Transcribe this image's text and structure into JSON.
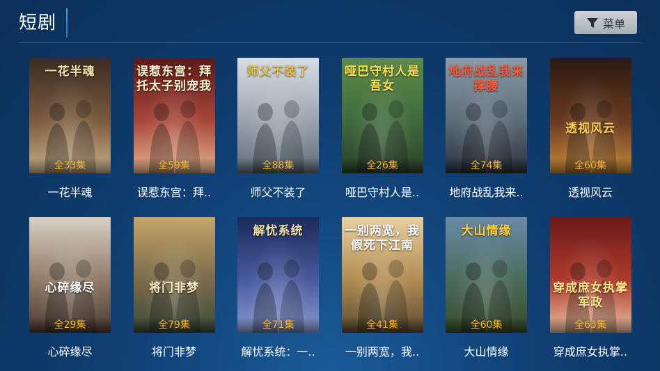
{
  "header": {
    "title": "短剧",
    "menu_label": "菜单",
    "menu_icon": "filter-icon"
  },
  "items": [
    {
      "title": "一花半魂",
      "episodes": "全33集",
      "poster_text": "一花半魂",
      "theme": [
        "#3b2b22",
        "#7a5b3e",
        "#c8b08a"
      ],
      "text_color": "#f2e2b0"
    },
    {
      "title": "误惹东宫：拜..",
      "episodes": "全59集",
      "poster_text": "误惹东宫：拜托太子别宠我",
      "theme": [
        "#5a1a18",
        "#a8463a",
        "#e6b58c"
      ],
      "text_color": "#fff4d0"
    },
    {
      "title": "师父不装了",
      "episodes": "全88集",
      "poster_text": "师父不装了",
      "theme": [
        "#d9dde3",
        "#9aa3ad",
        "#5d6b78"
      ],
      "text_color": "#e8c24a"
    },
    {
      "title": "哑巴守村人是..",
      "episodes": "全26集",
      "poster_text": "哑巴守村人是吾女",
      "theme": [
        "#5f8a4a",
        "#3f6a3c",
        "#2a3f2a"
      ],
      "text_color": "#ffe04a"
    },
    {
      "title": "地府战乱我来..",
      "episodes": "全74集",
      "poster_text": "地府战乱我来撑腰",
      "theme": [
        "#8a9aa6",
        "#5c6b78",
        "#2a2f3a"
      ],
      "text_color": "#ff5a3a"
    },
    {
      "title": "透视风云",
      "episodes": "全60集",
      "poster_text": "透视风云",
      "theme": [
        "#2a1a12",
        "#6a3a1e",
        "#c88a3a"
      ],
      "text_color": "#ffcf55"
    },
    {
      "title": "心碎缘尽",
      "episodes": "全29集",
      "poster_text": "心碎缘尽",
      "theme": [
        "#d8cfc4",
        "#8f7a68",
        "#4a3a30"
      ],
      "text_color": "#ffffff"
    },
    {
      "title": "将门非梦",
      "episodes": "全79集",
      "poster_text": "将门非梦",
      "theme": [
        "#c4a46a",
        "#7a6a4a",
        "#3a4a3a"
      ],
      "text_color": "#fff0c8"
    },
    {
      "title": "解忧系统：一..",
      "episodes": "全71集",
      "poster_text": "解忧系统",
      "theme": [
        "#1a2a5a",
        "#4a5aa0",
        "#8a9ad0"
      ],
      "text_color": "#f0e0a0"
    },
    {
      "title": "一别两宽，我..",
      "episodes": "全41集",
      "poster_text": "一别两宽，我假死下江南",
      "theme": [
        "#e8d0a0",
        "#b08a50",
        "#5a4a30"
      ],
      "text_color": "#ffffff"
    },
    {
      "title": "大山情缘",
      "episodes": "全60集",
      "poster_text": "大山情缘",
      "theme": [
        "#6a8aa8",
        "#4a6a5a",
        "#3a4a2a"
      ],
      "text_color": "#ffd23a"
    },
    {
      "title": "穿成庶女执掌..",
      "episodes": "全63集",
      "poster_text": "穿成庶女执掌军政",
      "theme": [
        "#6a1a1a",
        "#b03a2a",
        "#e8c0a0"
      ],
      "text_color": "#ffe68a"
    }
  ]
}
